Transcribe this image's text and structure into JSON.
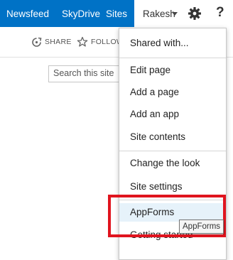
{
  "suite_bar": {
    "links": [
      "Newsfeed",
      "SkyDrive",
      "Sites"
    ],
    "user_name": "Rakesh",
    "help_label": "?",
    "colors": {
      "background": "#0072c6",
      "text": "#ffffff"
    }
  },
  "action_bar": {
    "share_label": "SHARE",
    "follow_label": "FOLLOW"
  },
  "search": {
    "placeholder": "Search this site"
  },
  "settings_menu": {
    "items": [
      "Shared with...",
      "Edit page",
      "Add a page",
      "Add an app",
      "Site contents",
      "Change the look",
      "Site settings",
      "AppForms",
      "Getting started"
    ],
    "hovered_item": "AppForms"
  },
  "tooltip": {
    "text": "AppForms"
  },
  "annotation": {
    "highlight_color": "#e0141e"
  }
}
